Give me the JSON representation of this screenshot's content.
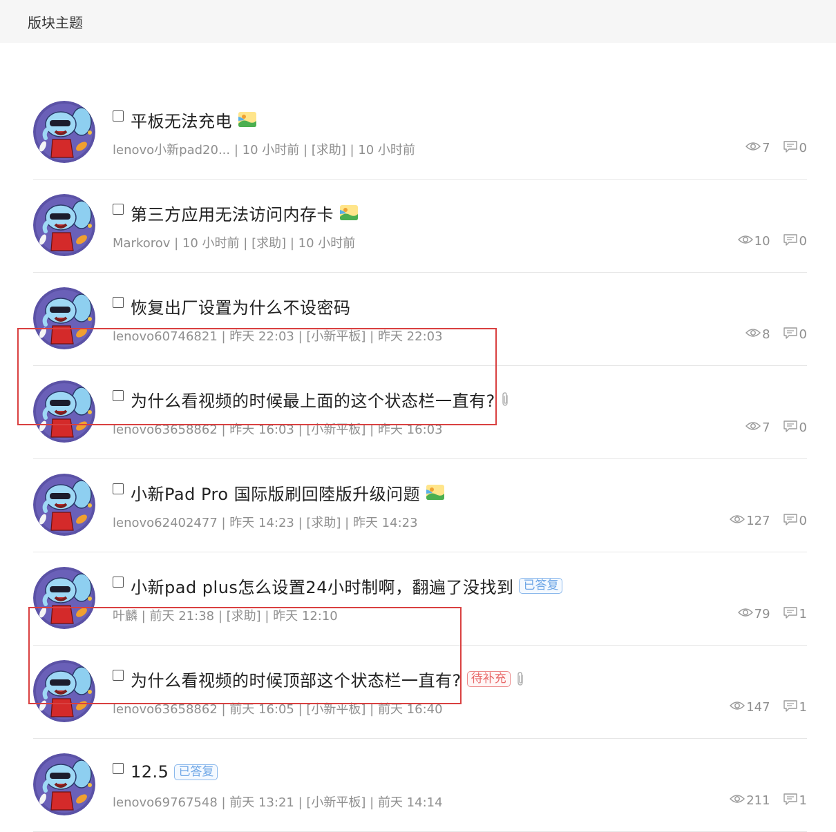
{
  "header": {
    "title": "版块主题"
  },
  "threads": [
    {
      "title": "平板无法充电",
      "tag": null,
      "tag_color": null,
      "attachment": "image-icon",
      "meta": "lenovo小新pad20... | 10 小时前 | [求助] | 10 小时前",
      "views": "7",
      "replies": "0"
    },
    {
      "title": "第三方应用无法访问内存卡",
      "tag": null,
      "tag_color": null,
      "attachment": "image-icon",
      "meta": "Markorov | 10 小时前 | [求助] | 10 小时前",
      "views": "10",
      "replies": "0"
    },
    {
      "title": "恢复出厂设置为什么不设密码",
      "tag": null,
      "tag_color": null,
      "attachment": null,
      "meta": "lenovo60746821 | 昨天 22:03 | [小新平板] | 昨天 22:03",
      "views": "8",
      "replies": "0"
    },
    {
      "title": "为什么看视频的时候最上面的这个状态栏一直有?",
      "tag": null,
      "tag_color": null,
      "attachment": "paperclip-icon",
      "meta": "lenovo63658862 | 昨天 16:03 | [小新平板] | 昨天 16:03",
      "views": "7",
      "replies": "0"
    },
    {
      "title": "小新Pad Pro 国际版刷回陸版升级问题",
      "tag": null,
      "tag_color": null,
      "attachment": "image-icon",
      "meta": "lenovo62402477 | 昨天 14:23 | [求助] | 昨天 14:23",
      "views": "127",
      "replies": "0"
    },
    {
      "title": "小新pad plus怎么设置24小时制啊，翻遍了没找到",
      "tag": "已答复",
      "tag_color": "blue",
      "attachment": null,
      "meta": "叶麟 | 前天 21:38 | [求助] | 昨天 12:10",
      "views": "79",
      "replies": "1"
    },
    {
      "title": "为什么看视频的时候顶部这个状态栏一直有?",
      "tag": "待补充",
      "tag_color": "red",
      "attachment": "paperclip-icon",
      "meta": "lenovo63658862 | 前天 16:05 | [小新平板] | 前天 16:40",
      "views": "147",
      "replies": "1"
    },
    {
      "title": "12.5",
      "tag": "已答复",
      "tag_color": "blue",
      "attachment": null,
      "meta": "lenovo69767548 | 前天 13:21 | [小新平板] | 前天 14:14",
      "views": "211",
      "replies": "1"
    }
  ],
  "colors": {
    "highlight": "#d94040",
    "tag_blue": "#6ea6e6",
    "tag_red": "#e86a6a",
    "meta_text": "#8f8f8f"
  },
  "icons": {
    "views": "eye-icon",
    "replies": "comment-icon",
    "image": "image-icon",
    "attachment": "paperclip-icon"
  }
}
